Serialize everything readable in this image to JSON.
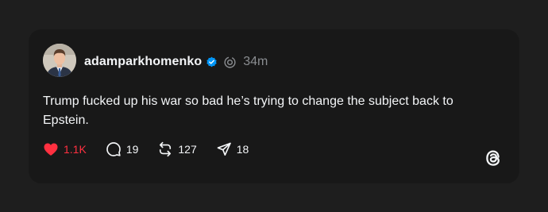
{
  "post": {
    "username": "adamparkhomenko",
    "time": "34m",
    "text": "Trump fucked up his war so bad he’s trying to change the subject back to Epstein."
  },
  "actions": {
    "likes": "1.1K",
    "replies": "19",
    "reposts": "127",
    "shares": "18"
  },
  "colors": {
    "background": "#1e1e1e",
    "card": "#181818",
    "like_active": "#ff3040",
    "verified": "#0095f6",
    "muted": "#8a8d91"
  },
  "icons": {
    "verified": "verified-badge-icon",
    "threads_mark": "threads-mark-icon",
    "like": "heart-icon",
    "reply": "comment-icon",
    "repost": "repost-icon",
    "share": "send-icon",
    "logo": "threads-logo-icon"
  }
}
